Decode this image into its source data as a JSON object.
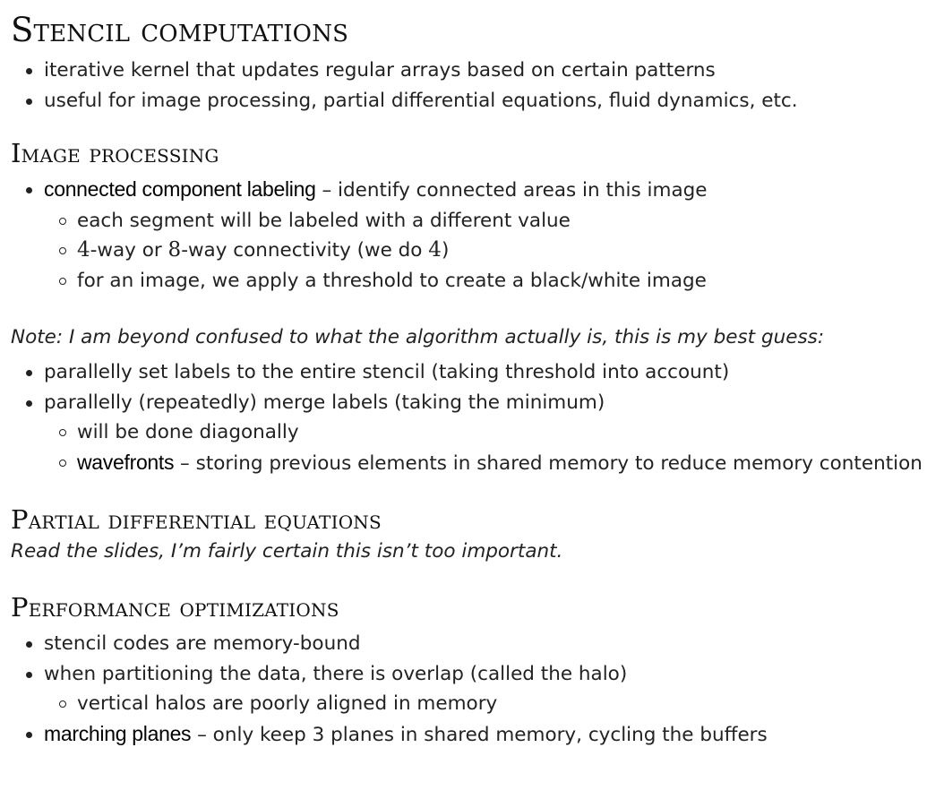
{
  "sections": {
    "stencil": {
      "title": "Stencil computations",
      "items": [
        "iterative kernel that updates regular arrays based on certain patterns",
        "useful for image processing, partial differential equations, fluid dynamics, etc."
      ]
    },
    "image": {
      "title": "Image processing",
      "ccl": {
        "term": "connected component labeling",
        "text": " – identify connected areas in this image",
        "sub": {
          "segment": "each segment will be labeled with a different value",
          "connectivity": {
            "n1": "4",
            "t1": "-way or ",
            "n2": "8",
            "t2": "-way connectivity (we do ",
            "n3": "4",
            "t3": ")"
          },
          "threshold": "for an image, we apply a threshold to create a black/white image"
        }
      },
      "note": "Note: I am beyond confused to what the algorithm actually is, this is my best guess:",
      "algo": {
        "set": "parallelly set labels to the entire stencil (taking threshold into account)",
        "merge": "parallelly (repeatedly) merge labels (taking the minimum)",
        "diag": "will be done diagonally",
        "wave_term": "wavefronts",
        "wave_text": " – storing previous elements in shared memory to reduce memory contention"
      }
    },
    "pde": {
      "title": "Partial differential equations",
      "note": "Read the slides, I’m fairly certain this isn’t too important."
    },
    "perf": {
      "title": "Performance optimizations",
      "items": {
        "memory": "stencil codes are memory-bound",
        "halo": "when partitioning the data, there is overlap (called the halo)",
        "vertical": "vertical halos are poorly aligned in memory",
        "march_term": "marching planes",
        "march_text": " – only keep 3 planes in shared memory, cycling the buffers"
      }
    }
  }
}
